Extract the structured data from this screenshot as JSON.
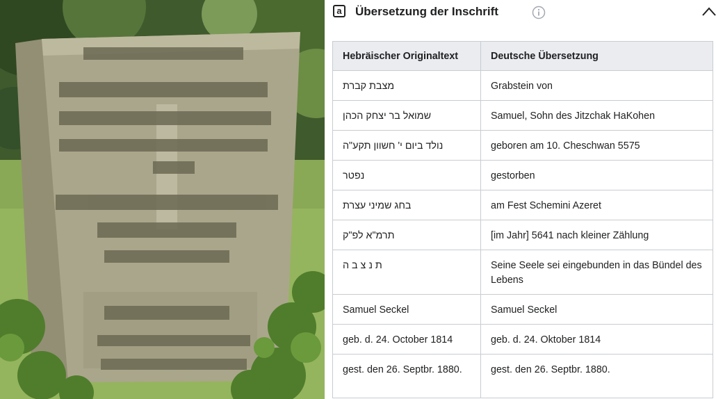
{
  "panel": {
    "badge_letter": "a",
    "title": "Übersetzung der Inschrift",
    "info_icon": "info-icon",
    "collapse_icon": "chevron-up-icon"
  },
  "table": {
    "headers": [
      "Hebräischer Originaltext",
      "Deutsche Übersetzung"
    ],
    "rows": [
      {
        "original": "מצבת קברת",
        "translation": "Grabstein von"
      },
      {
        "original": "שמואל בר יצחק הכהן",
        "translation": "Samuel, Sohn des Jitzchak HaKohen"
      },
      {
        "original": "נולד ביום י' חשוון תקע\"ה",
        "translation": "geboren am 10. Cheschwan 5575"
      },
      {
        "original": "נפטר",
        "translation": "gestorben"
      },
      {
        "original": "בחג שמיני עצרת",
        "translation": "am Fest Schemini Azeret"
      },
      {
        "original": "תרמ\"א לפ\"ק",
        "translation": "[im Jahr] 5641 nach kleiner Zählung"
      },
      {
        "original": "ת נ צ ב ה",
        "translation": "Seine Seele sei eingebunden in das Bündel des Lebens"
      },
      {
        "original": "Samuel Seckel",
        "translation": "Samuel Seckel"
      },
      {
        "original": "geb. d. 24. October 1814",
        "translation": "geb. d. 24. Oktober 1814"
      },
      {
        "original": "gest. den 26. Septbr. 1880.",
        "translation": "gest. den 26. Septbr. 1880."
      }
    ]
  },
  "photo": {
    "description_icon": "gravestone-photo",
    "colors": {
      "stone": "#a8a48a",
      "stone_dark": "#7d7a62",
      "grass": "#8fae55",
      "ivy": "#4f7d2c"
    }
  }
}
